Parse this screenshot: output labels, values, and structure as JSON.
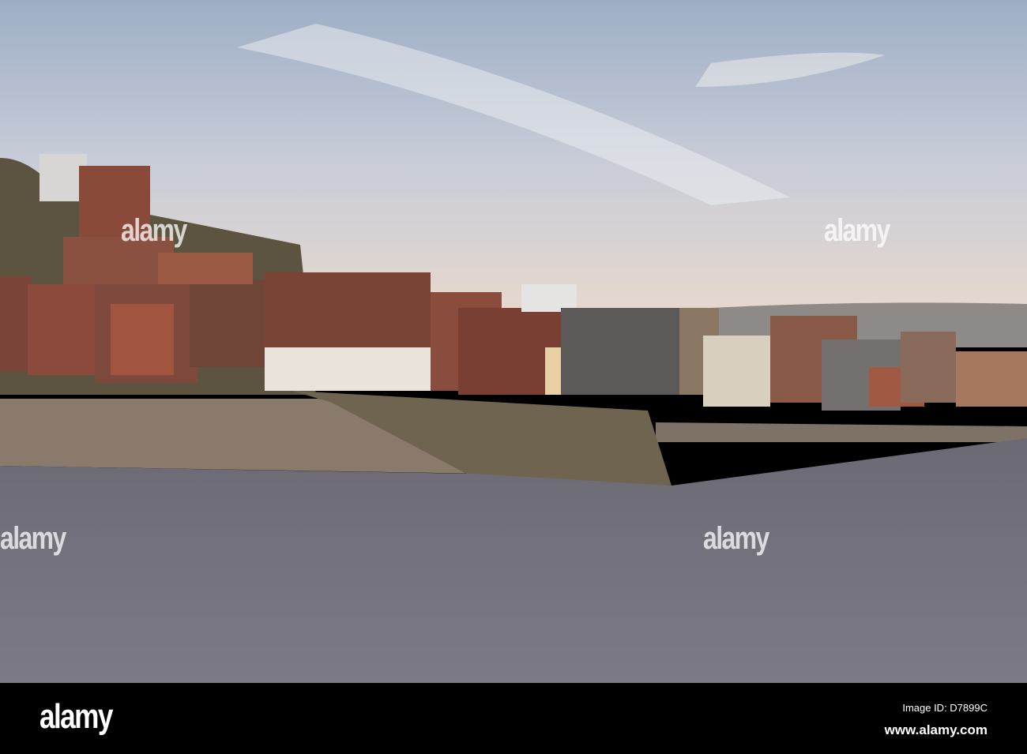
{
  "photo": {
    "subject": "harbour town with houses, pier and water"
  },
  "watermark": {
    "brand": "alamy",
    "small_mark": "a"
  },
  "footer": {
    "logo": "alamy",
    "image_id": "Image ID: D7899C",
    "website": "www.alamy.com"
  }
}
